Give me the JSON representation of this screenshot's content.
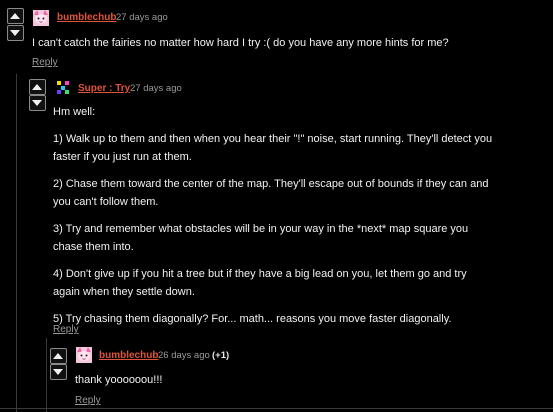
{
  "comments": [
    {
      "author": "bumblechub",
      "timestamp": "27 days ago",
      "body": [
        "I can't catch the fairies no matter how hard I try :( do you have any more hints for me?"
      ],
      "reply_label": "Reply",
      "avatar_icon": "pink-cat-avatar-icon"
    },
    {
      "author": "Super : Try",
      "timestamp": "27 days ago",
      "body": [
        "Hm well:",
        "1) Walk up to them and then when you hear their \"!\" noise, start running. They'll detect you faster if you just run at them.",
        "2) Chase them toward the center of the map. They'll escape out of bounds if they can and you can't follow them.",
        "3) Try and remember what obstacles will be in your way in the *next* map square you chase them into.",
        "4) Don't give up if you hit a tree but if they have a big lead on you, let them go and try again when they settle down.",
        "5) Try chasing them diagonally? For... math... reasons you move faster diagonally."
      ],
      "reply_label": "Reply",
      "avatar_icon": "pixel-blocks-avatar-icon"
    },
    {
      "author": "bumblechub",
      "timestamp": "26 days ago",
      "points": "(+1)",
      "body": [
        "thank yoooooou!!!"
      ],
      "reply_label": "Reply",
      "avatar_icon": "pink-cat-avatar-icon"
    }
  ],
  "colors": {
    "background": "#000000",
    "author_link": "#e0553a",
    "meta_text": "#9a9a9a",
    "body_text": "#f2f2f2",
    "vote_border": "#8a8a8a"
  }
}
